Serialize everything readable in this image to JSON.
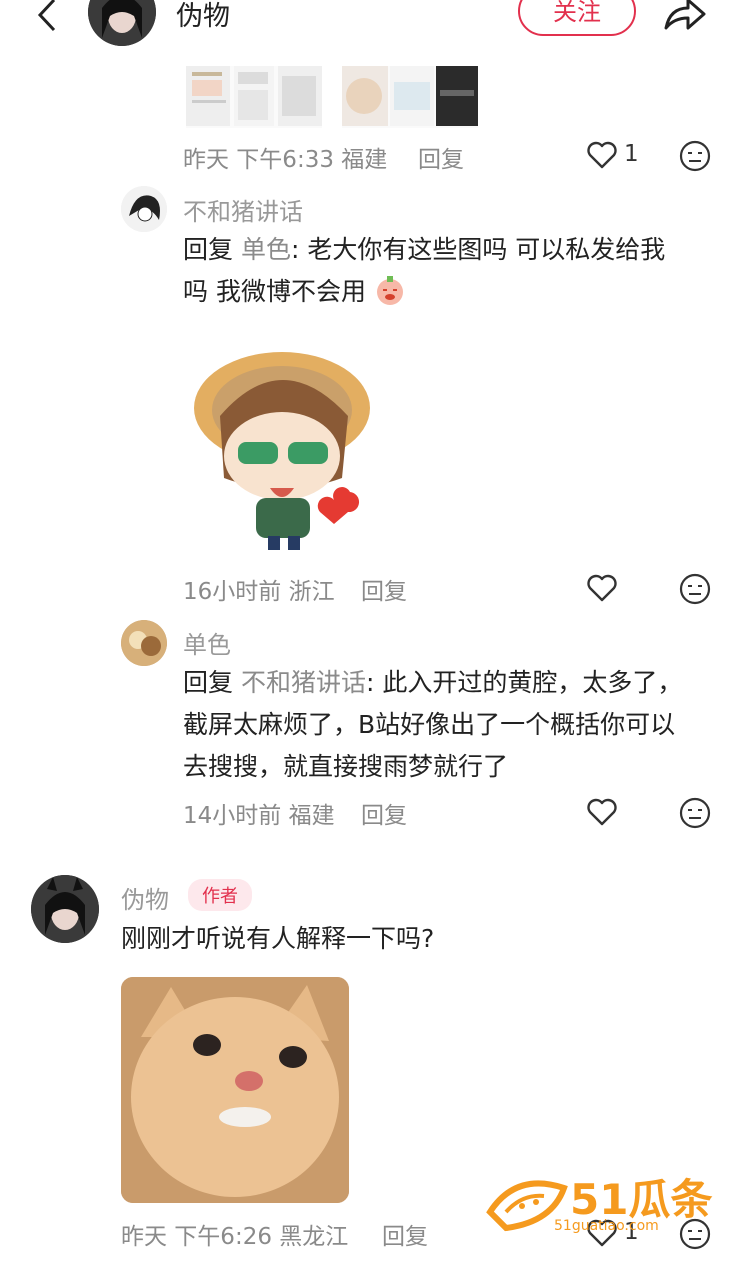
{
  "header": {
    "username": "伪物",
    "follow_label": "关注"
  },
  "comment_top": {
    "meta": "昨天 下午6:33 福建",
    "reply_label": "回复",
    "like_count": "1"
  },
  "comment_1": {
    "username": "不和猪讲话",
    "reply_prefix": "回复",
    "reply_to": "单色",
    "text_line1": ": 老大你有这些图吗 可以私发给我",
    "text_line2": "吗 我微博不会用",
    "meta": "16小时前 浙江",
    "reply_label": "回复"
  },
  "comment_2": {
    "username": "单色",
    "reply_prefix": "回复",
    "reply_to": "不和猪讲话",
    "text_line1": ": 此入开过的黄腔，太多了，",
    "text_line2": "截屏太麻烦了，B站好像出了一个概括你可以",
    "text_line3": "去搜搜，就直接搜雨梦就行了",
    "meta": "14小时前 福建",
    "reply_label": "回复"
  },
  "comment_3": {
    "username": "伪物",
    "badge": "作者",
    "text": "刚刚才听说有人解释一下吗?",
    "meta": "昨天 下午6:26 黑龙江",
    "reply_label": "回复",
    "like_count": "1"
  },
  "watermark": {
    "brand": "51瓜条",
    "url": "51guatiao.com"
  },
  "colors": {
    "accent": "#e2304d",
    "watermark": "#f59a1e"
  }
}
